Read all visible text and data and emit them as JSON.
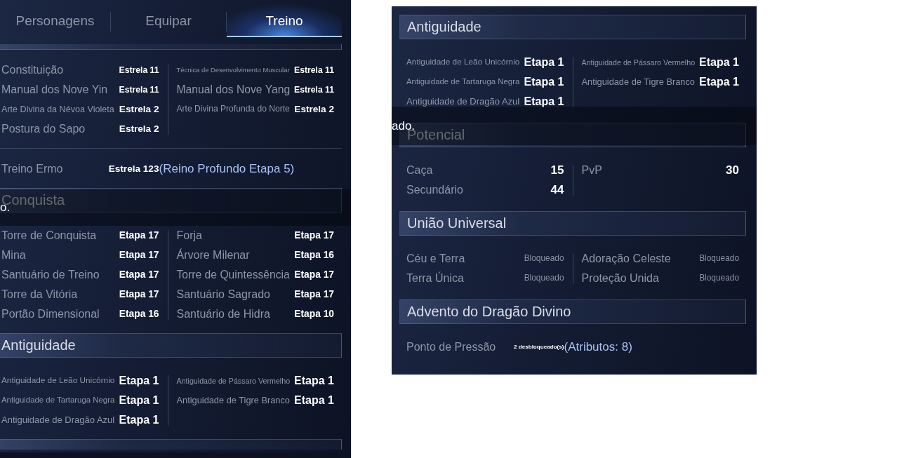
{
  "left_panel": {
    "tabs": [
      {
        "label": "Personagens",
        "selected": false
      },
      {
        "label": "Equipar",
        "selected": false
      },
      {
        "label": "Treino",
        "selected": true
      }
    ],
    "sections": [
      {
        "kind": "scrolled_top",
        "groups": [
          {
            "kind": "pairs",
            "columns": [
              [
                {
                  "label": "Constituição",
                  "value": "Estrela 11"
                },
                {
                  "label": "Manual dos Nove Yin",
                  "value": "Estrela 11"
                },
                {
                  "label": "Arte Divina da Névoa Violeta",
                  "value": "Estrela 2"
                },
                {
                  "label": "Postura do Sapo",
                  "value": "Estrela 2"
                }
              ],
              [
                {
                  "label": "Técnica de Desenvolvimento Muscular",
                  "value": "Estrela 11"
                },
                {
                  "label": "Manual dos Nove Yang",
                  "value": "Estrela 11"
                },
                {
                  "label": "Arte Divina Profunda do Norte",
                  "value": "Estrela 2"
                }
              ]
            ]
          },
          {
            "kind": "wide",
            "label": "Treino Ermo",
            "value": "Estrela 123",
            "note": "(Reino Profundo Etapa 5)"
          }
        ]
      },
      {
        "kind": "full",
        "title": "Conquista",
        "groups": [
          {
            "kind": "pairs",
            "columns": [
              [
                {
                  "label": "Torre de Conquista",
                  "value": "Etapa 17"
                },
                {
                  "label": "Mina",
                  "value": "Etapa 17"
                },
                {
                  "label": "Santuário de Treino",
                  "value": "Etapa 17"
                },
                {
                  "label": "Torre da Vitória",
                  "value": "Etapa 17"
                },
                {
                  "label": "Portão Dimensional",
                  "value": "Etapa 16"
                }
              ],
              [
                {
                  "label": "Forja",
                  "value": "Etapa 17"
                },
                {
                  "label": "Árvore Milenar",
                  "value": "Etapa 16"
                },
                {
                  "label": "Torre de Quintessência",
                  "value": "Etapa 17"
                },
                {
                  "label": "Santuário Sagrado",
                  "value": "Etapa 17"
                },
                {
                  "label": "Santuário de Hidra",
                  "value": "Etapa 10"
                }
              ]
            ]
          }
        ]
      },
      {
        "kind": "full",
        "title": "Antiguidade",
        "groups": [
          {
            "kind": "pairs",
            "columns": [
              [
                {
                  "label": "Antiguidade de Leão Unicórnio",
                  "value": "Etapa 1"
                },
                {
                  "label": "Antiguidade de Tartaruga Negra",
                  "value": "Etapa 1"
                },
                {
                  "label": "Antiguidade de Dragão Azul",
                  "value": "Etapa 1"
                }
              ],
              [
                {
                  "label": "Antiguidade de Pássaro Vermelho",
                  "value": "Etapa 1"
                },
                {
                  "label": "Antiguidade de Tigre Branco",
                  "value": "Etapa 1"
                }
              ]
            ]
          }
        ]
      },
      {
        "kind": "scrolled_bottom"
      }
    ],
    "toast": {
      "text": "o."
    }
  },
  "right_panel": {
    "sections": [
      {
        "kind": "full",
        "title": "Antiguidade",
        "groups": [
          {
            "kind": "pairs",
            "columns": [
              [
                {
                  "label": "Antiguidade de Leão Unicórnio",
                  "value": "Etapa 1"
                },
                {
                  "label": "Antiguidade de Tartaruga Negra",
                  "value": "Etapa 1"
                },
                {
                  "label": "Antiguidade de Dragão Azul",
                  "value": "Etapa 1"
                }
              ],
              [
                {
                  "label": "Antiguidade de Pássaro Vermelho",
                  "value": "Etapa 1"
                },
                {
                  "label": "Antiguidade de Tigre Branco",
                  "value": "Etapa 1"
                }
              ]
            ]
          }
        ]
      },
      {
        "kind": "full",
        "title": "Potencial",
        "groups": [
          {
            "kind": "pairs",
            "columns": [
              [
                {
                  "label": "Caça",
                  "value": "15"
                },
                {
                  "label": "Secundário",
                  "value": "44"
                }
              ],
              [
                {
                  "label": "PvP",
                  "value": "30"
                }
              ]
            ]
          }
        ]
      },
      {
        "kind": "full",
        "title": "União Universal",
        "groups": [
          {
            "kind": "pairs",
            "columns": [
              [
                {
                  "label": "Céu e Terra",
                  "value": "Bloqueado",
                  "locked": true
                },
                {
                  "label": "Terra Única",
                  "value": "Bloqueado",
                  "locked": true
                }
              ],
              [
                {
                  "label": "Adoração Celeste",
                  "value": "Bloqueado",
                  "locked": true
                },
                {
                  "label": "Proteção Unida",
                  "value": "Bloqueado",
                  "locked": true
                }
              ]
            ]
          }
        ]
      },
      {
        "kind": "full",
        "title": "Advento do Dragão Divino",
        "groups": [
          {
            "kind": "wide",
            "label": "Ponto de Pressão",
            "value": "2 desbloqueado(s)",
            "note": "(Atributos: 8)"
          }
        ]
      }
    ],
    "toast": {
      "text": "ado."
    }
  }
}
